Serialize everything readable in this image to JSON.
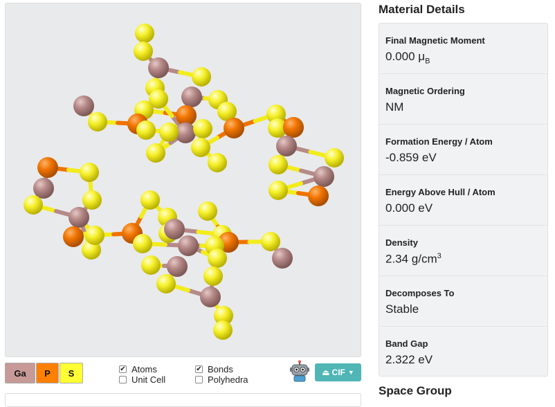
{
  "legend": {
    "ga": "Ga",
    "p": "P",
    "s": "S"
  },
  "options": {
    "atoms": "Atoms",
    "bonds": "Bonds",
    "unit_cell": "Unit Cell",
    "polyhedra": "Polyhedra",
    "atoms_checked": true,
    "bonds_checked": true,
    "unit_cell_checked": false,
    "polyhedra_checked": false
  },
  "download": {
    "label": "CIF"
  },
  "colors": {
    "ga": "#c79a98",
    "p": "#ff8000",
    "s": "#ffff33",
    "bond": "#ffff44",
    "button": "#4fb5b5"
  },
  "details": {
    "title": "Material Details",
    "final_magnetic_moment": {
      "label": "Final Magnetic Moment",
      "value": "0.000 μ",
      "unit_sub": "B"
    },
    "magnetic_ordering": {
      "label": "Magnetic Ordering",
      "value": "NM"
    },
    "formation_energy": {
      "label": "Formation Energy / Atom",
      "value": "-0.859 eV"
    },
    "energy_above_hull": {
      "label": "Energy Above Hull / Atom",
      "value": "0.000 eV"
    },
    "density": {
      "label": "Density",
      "value": "2.34 g/cm",
      "unit_sup": "3"
    },
    "decomposes_to": {
      "label": "Decomposes To",
      "value": "Stable"
    },
    "band_gap": {
      "label": "Band Gap",
      "value": "2.322 eV"
    }
  },
  "space_group_title": "Space Group"
}
